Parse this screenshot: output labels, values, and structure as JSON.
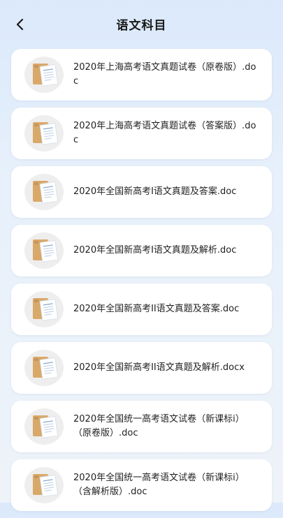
{
  "header": {
    "title": "语文科目",
    "back_icon": "chevron-left-icon"
  },
  "files": [
    {
      "name": "2020年上海高考语文真题试卷（原卷版）.doc"
    },
    {
      "name": "2020年上海高考语文真题试卷（答案版）.doc"
    },
    {
      "name": "2020年全国新高考I语文真题及答案.doc"
    },
    {
      "name": "2020年全国新高考I语文真题及解析.doc"
    },
    {
      "name": "2020年全国新高考II语文真题及答案.doc"
    },
    {
      "name": "2020年全国新高考II语文真题及解析.docx"
    },
    {
      "name": "2020年全国统一高考语文试卷（新课标i）（原卷版）.doc"
    },
    {
      "name": "2020年全国统一高考语文试卷（新课标i）（含解析版）.doc"
    }
  ],
  "colors": {
    "folder": "#d9a96a",
    "paper": "#ffffff",
    "paper_lines": "#8fb0d8",
    "thumb_bg": "#eeeeee"
  }
}
